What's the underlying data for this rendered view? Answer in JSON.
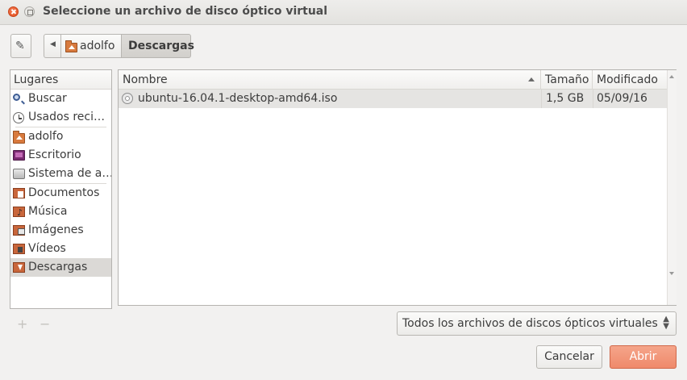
{
  "window": {
    "title": "Seleccione un archivo de disco óptico virtual"
  },
  "toolbar": {
    "path": [
      {
        "label": "adolfo",
        "icon": "home-folder-icon"
      },
      {
        "label": "Descargas",
        "icon": null
      }
    ]
  },
  "places": {
    "header": "Lugares",
    "items": [
      {
        "label": "Buscar",
        "icon": "search-icon",
        "selected": false
      },
      {
        "label": "Usados reci…",
        "icon": "recent-clock-icon",
        "selected": false
      },
      {
        "label": "adolfo",
        "icon": "home-folder-icon",
        "selected": false
      },
      {
        "label": "Escritorio",
        "icon": "desktop-icon",
        "selected": false
      },
      {
        "label": "Sistema de a…",
        "icon": "drive-icon",
        "selected": false
      },
      {
        "label": "Documentos",
        "icon": "documents-folder-icon",
        "selected": false
      },
      {
        "label": "Música",
        "icon": "music-folder-icon",
        "selected": false
      },
      {
        "label": "Imágenes",
        "icon": "pictures-folder-icon",
        "selected": false
      },
      {
        "label": "Vídeos",
        "icon": "videos-folder-icon",
        "selected": false
      },
      {
        "label": "Descargas",
        "icon": "downloads-folder-icon",
        "selected": true
      }
    ],
    "add_symbol": "+",
    "remove_symbol": "−"
  },
  "filelist": {
    "columns": [
      "Nombre",
      "Tamaño",
      "Modificado"
    ],
    "rows": [
      {
        "name": "ubuntu-16.04.1-desktop-amd64.iso",
        "size": "1,5 GB",
        "modified": "05/09/16",
        "icon": "disc-image-icon"
      }
    ]
  },
  "filter": {
    "selected": "Todos los archivos de discos ópticos virtuales"
  },
  "buttons": {
    "cancel": "Cancelar",
    "open": "Abrir"
  },
  "colors": {
    "accent": "#ef8a6b",
    "selection": "#dbd9d6",
    "folder": "#d87a3e"
  }
}
